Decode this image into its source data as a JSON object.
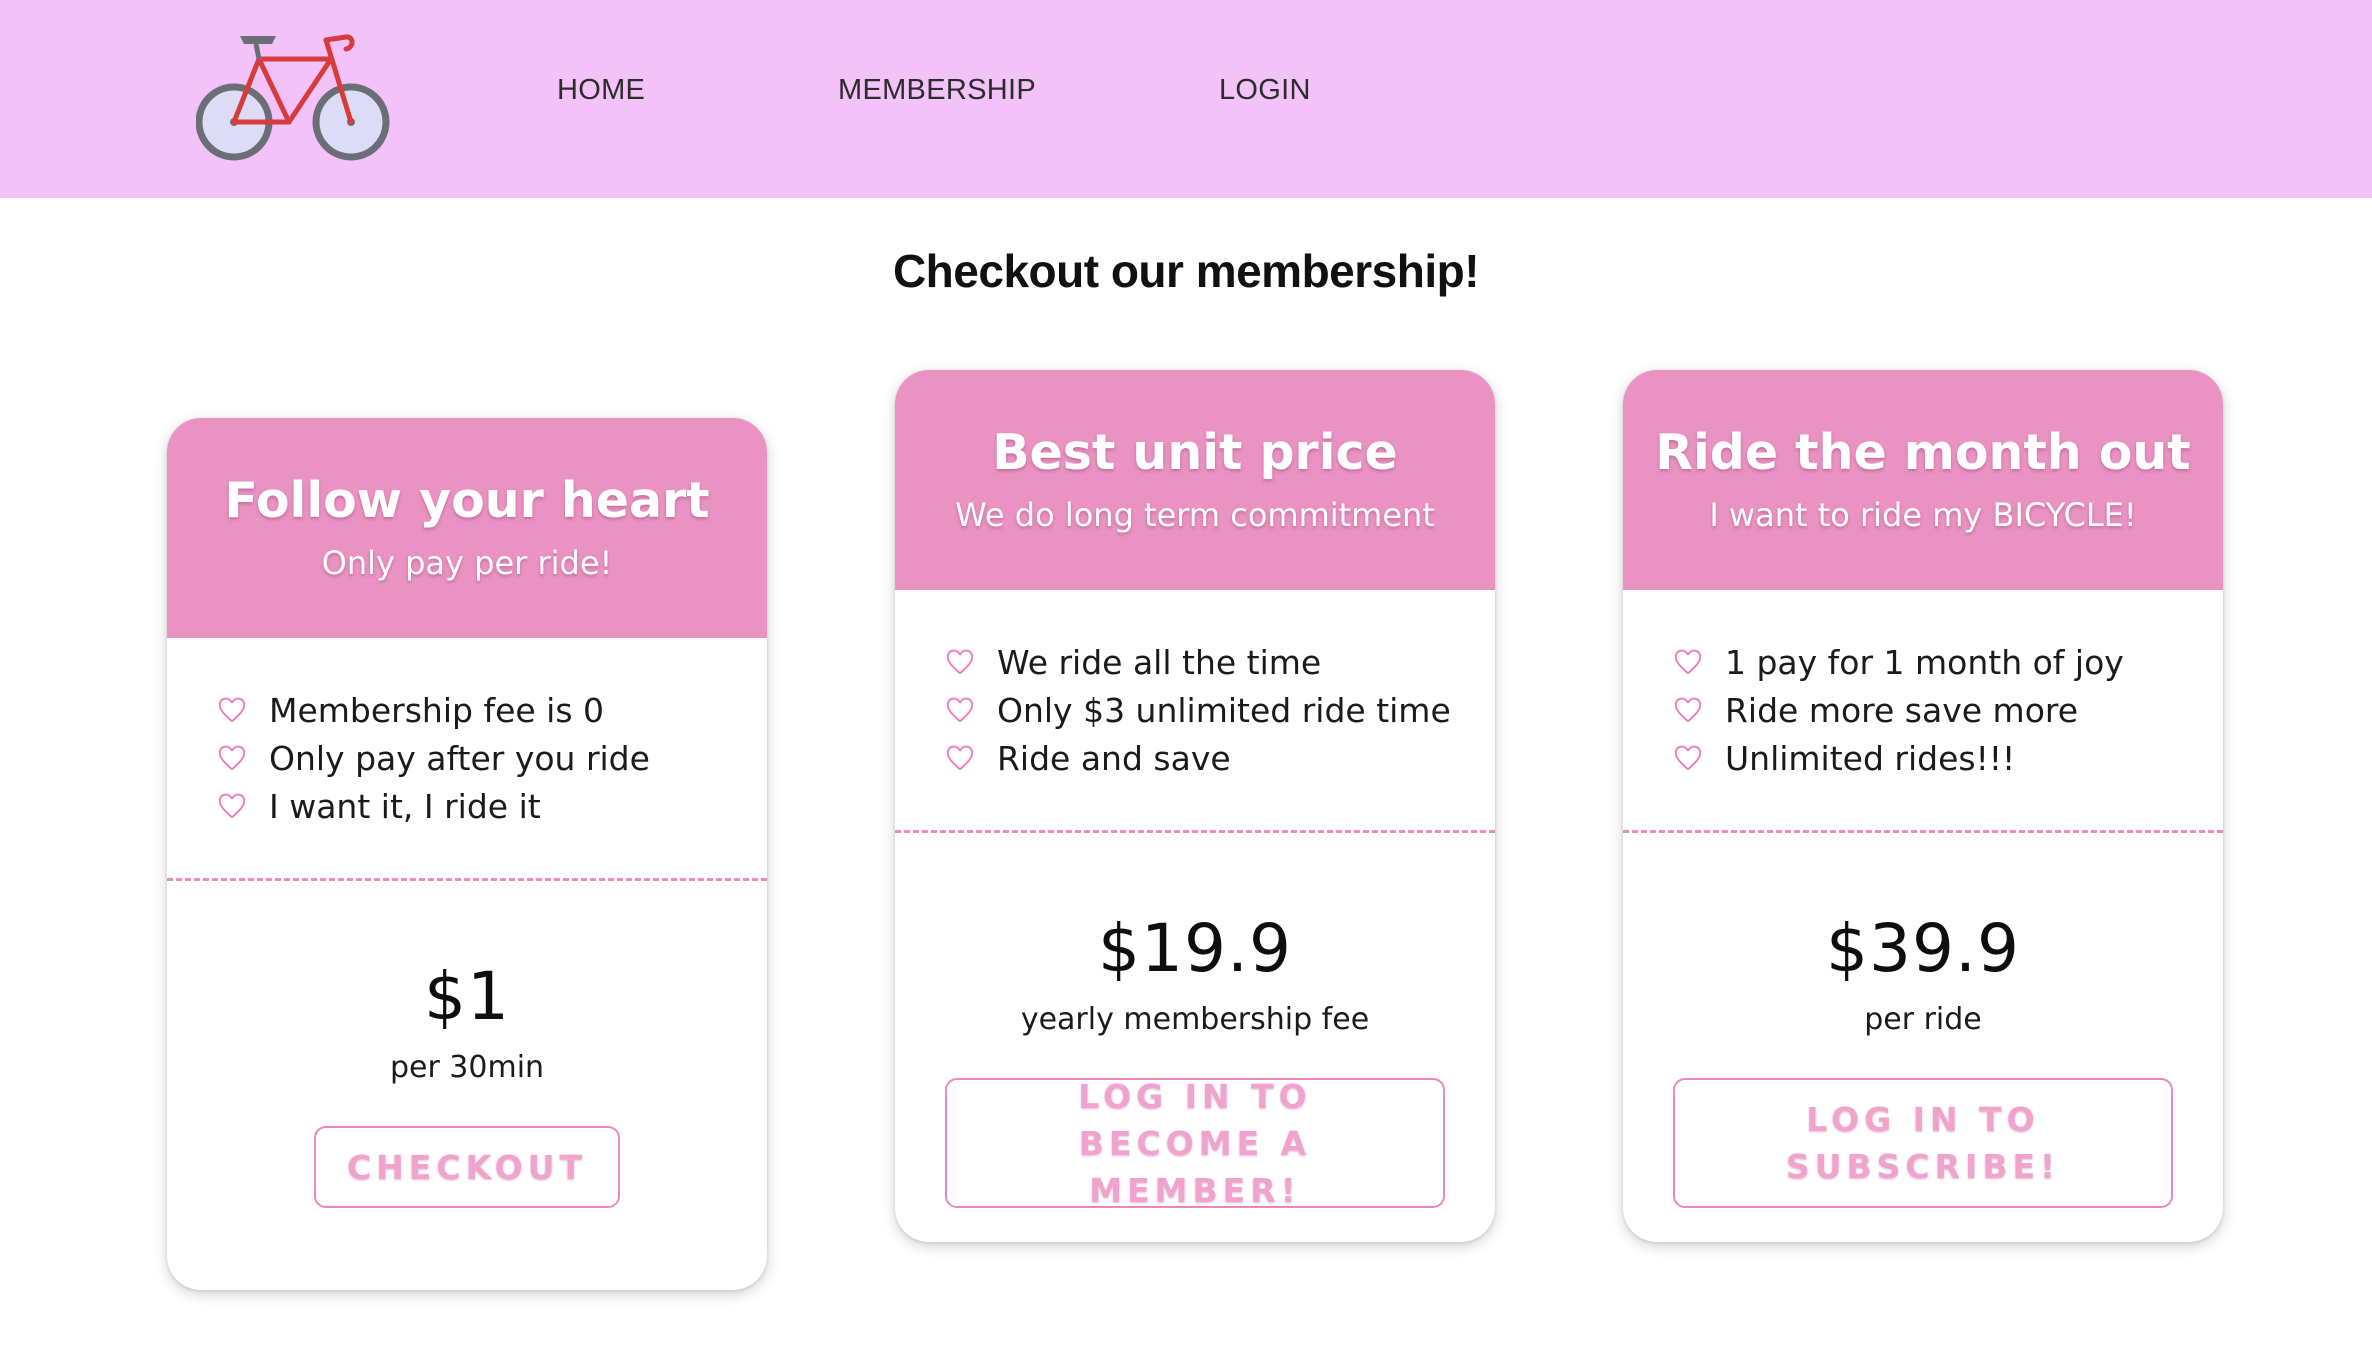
{
  "nav": {
    "logo_icon": "bicycle-icon",
    "links": [
      "HOME",
      "MEMBERSHIP",
      "LOGIN"
    ]
  },
  "page_title": "Checkout our membership!",
  "colors": {
    "navbar_bg": "#f2c2f9",
    "card_header_bg": "#ea93c3",
    "accent_pink": "#e988bf"
  },
  "cards": [
    {
      "title": "Follow your heart",
      "subtitle": "Only pay per ride!",
      "features": [
        "Membership fee is 0",
        "Only pay after you ride",
        "I want it, I ride it"
      ],
      "price": "$1",
      "price_unit": "per 30min",
      "button": "CHECKOUT"
    },
    {
      "title": "Best unit price",
      "subtitle": "We do long term commitment",
      "features": [
        "We ride all the time",
        "Only $3 unlimited ride time",
        "Ride and save"
      ],
      "price": "$19.9",
      "price_unit": "yearly membership fee",
      "button": "LOG IN TO BECOME A MEMBER!"
    },
    {
      "title": "Ride the month out",
      "subtitle": "I want to ride my BICYCLE!",
      "features": [
        "1 pay for 1 month of joy",
        "Ride more save more",
        "Unlimited rides!!!"
      ],
      "price": "$39.9",
      "price_unit": "per ride",
      "button": "LOG IN TO SUBSCRIBE!"
    }
  ],
  "feature_icon": "heart-outline-icon"
}
